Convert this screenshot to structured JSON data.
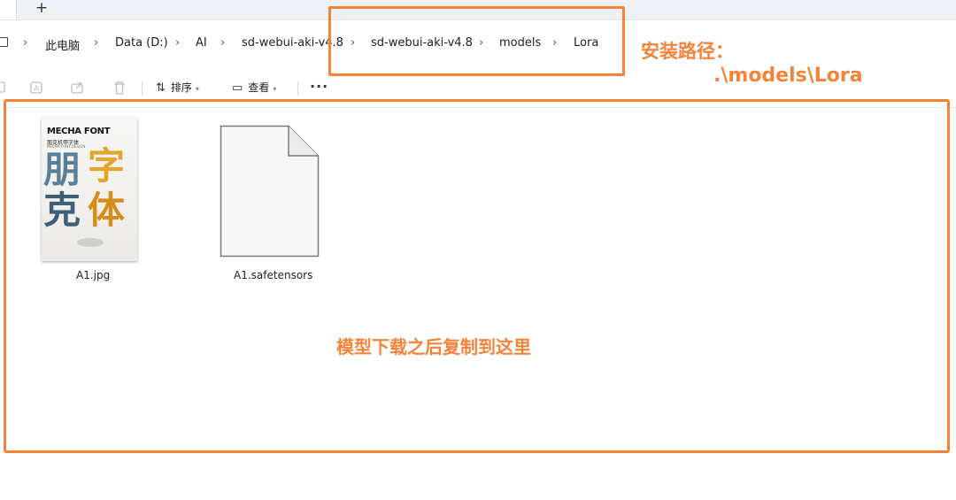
{
  "window": {
    "new_tab_label": "+"
  },
  "breadcrumbs": [
    {
      "label": "此电脑"
    },
    {
      "label": "Data (D:)"
    },
    {
      "label": "AI"
    },
    {
      "label": "sd-webui-aki-v4.8"
    },
    {
      "label": "sd-webui-aki-v4.8"
    },
    {
      "label": "models"
    },
    {
      "label": "Lora"
    }
  ],
  "breadcrumb_separator": "›",
  "toolbar": {
    "sort_label": "排序",
    "view_label": "查看",
    "more_label": "···",
    "sort_glyph": "⇅",
    "view_glyph": "▭",
    "dropdown_glyph": "▾",
    "icons": [
      "copy-icon",
      "rename-icon",
      "share-icon",
      "delete-icon"
    ]
  },
  "files": [
    {
      "name": "A1.jpg",
      "type": "image",
      "thumbnail": {
        "title": "MECHA FONT",
        "subtitle": "朋克机甲字体",
        "caption": "MECHA FONT DESIGN",
        "glyphs": [
          "朋",
          "字",
          "克",
          "体"
        ]
      }
    },
    {
      "name": "A1.safetensors",
      "type": "file"
    }
  ],
  "annotations": {
    "install_path_title": "安装路径：",
    "install_path_value": ".\\models\\Lora",
    "copy_hint": "模型下载之后复制到这里",
    "color": "#f5843a"
  }
}
